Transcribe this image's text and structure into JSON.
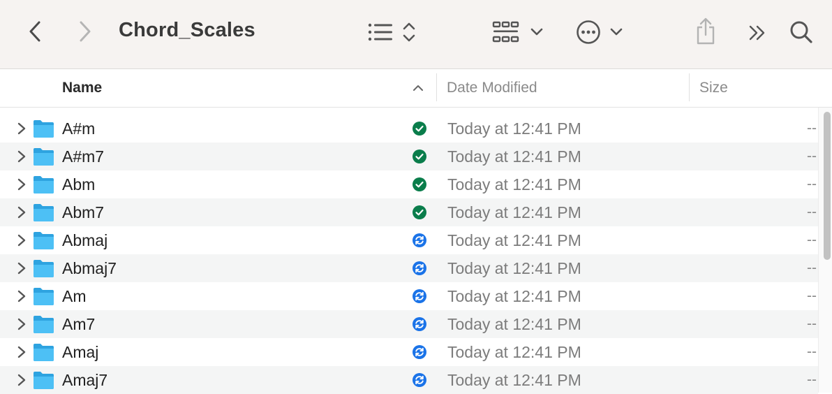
{
  "window": {
    "title": "Chord_Scales"
  },
  "toolbar": {
    "back_icon": "chevron-left-icon",
    "forward_icon": "chevron-right-icon",
    "list_view_icon": "list-icon",
    "group_icon": "grid-icon",
    "action_icon": "ellipsis-circle-icon",
    "share_icon": "share-icon",
    "more_icon": "double-chevron-icon",
    "search_icon": "magnifier-icon"
  },
  "columns": {
    "name": "Name",
    "date_modified": "Date Modified",
    "size": "Size"
  },
  "colors": {
    "synced": "#0a7d4b",
    "syncing": "#1a73e8",
    "folder": "#3fb3ec"
  },
  "rows": [
    {
      "name": "A#m",
      "status": "synced",
      "date": "Today at 12:41 PM",
      "size": "--"
    },
    {
      "name": "A#m7",
      "status": "synced",
      "date": "Today at 12:41 PM",
      "size": "--"
    },
    {
      "name": "Abm",
      "status": "synced",
      "date": "Today at 12:41 PM",
      "size": "--"
    },
    {
      "name": "Abm7",
      "status": "synced",
      "date": "Today at 12:41 PM",
      "size": "--"
    },
    {
      "name": "Abmaj",
      "status": "syncing",
      "date": "Today at 12:41 PM",
      "size": "--"
    },
    {
      "name": "Abmaj7",
      "status": "syncing",
      "date": "Today at 12:41 PM",
      "size": "--"
    },
    {
      "name": "Am",
      "status": "syncing",
      "date": "Today at 12:41 PM",
      "size": "--"
    },
    {
      "name": "Am7",
      "status": "syncing",
      "date": "Today at 12:41 PM",
      "size": "--"
    },
    {
      "name": "Amaj",
      "status": "syncing",
      "date": "Today at 12:41 PM",
      "size": "--"
    },
    {
      "name": "Amaj7",
      "status": "syncing",
      "date": "Today at 12:41 PM",
      "size": "--"
    }
  ]
}
